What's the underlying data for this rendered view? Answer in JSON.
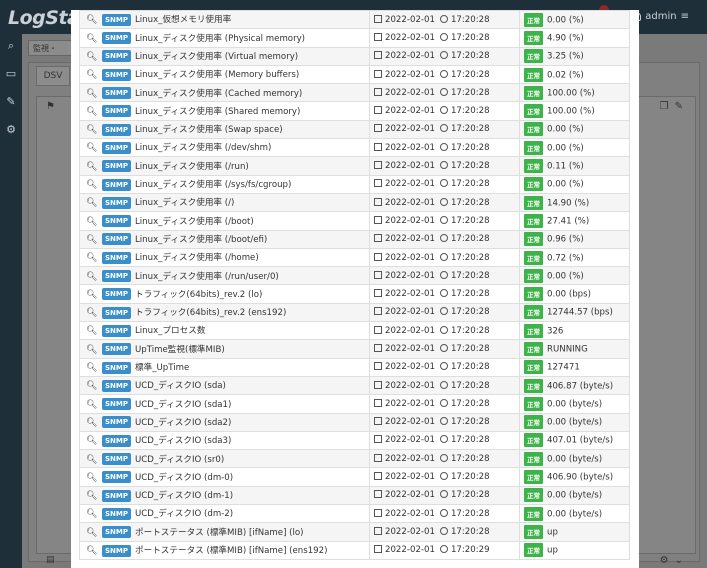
{
  "app": {
    "logo": "LogStar",
    "user": "admin",
    "search_label": "監視・",
    "tab_label": "DSV"
  },
  "colors": {
    "snmp_badge": "#3a8ec9",
    "status_ok": "#3db34a",
    "sidebar": "#1f2f3a"
  },
  "icons": [
    "search-icon",
    "monitor-icon",
    "wrench-icon",
    "gears-icon",
    "user-icon",
    "menu-icon",
    "calendar-icon",
    "clock-icon"
  ],
  "rows": [
    {
      "badge": "SNMP",
      "name": "Linux_仮想メモリ使用率",
      "date": "2022-02-01",
      "time": "17:20:28",
      "status": "正常",
      "value": "0.00 (%)"
    },
    {
      "badge": "SNMP",
      "name": "Linux_ディスク使用率 (Physical memory)",
      "date": "2022-02-01",
      "time": "17:20:28",
      "status": "正常",
      "value": "4.90 (%)"
    },
    {
      "badge": "SNMP",
      "name": "Linux_ディスク使用率 (Virtual memory)",
      "date": "2022-02-01",
      "time": "17:20:28",
      "status": "正常",
      "value": "3.25 (%)"
    },
    {
      "badge": "SNMP",
      "name": "Linux_ディスク使用率 (Memory buffers)",
      "date": "2022-02-01",
      "time": "17:20:28",
      "status": "正常",
      "value": "0.02 (%)"
    },
    {
      "badge": "SNMP",
      "name": "Linux_ディスク使用率 (Cached memory)",
      "date": "2022-02-01",
      "time": "17:20:28",
      "status": "正常",
      "value": "100.00 (%)"
    },
    {
      "badge": "SNMP",
      "name": "Linux_ディスク使用率 (Shared memory)",
      "date": "2022-02-01",
      "time": "17:20:28",
      "status": "正常",
      "value": "100.00 (%)"
    },
    {
      "badge": "SNMP",
      "name": "Linux_ディスク使用率 (Swap space)",
      "date": "2022-02-01",
      "time": "17:20:28",
      "status": "正常",
      "value": "0.00 (%)"
    },
    {
      "badge": "SNMP",
      "name": "Linux_ディスク使用率 (/dev/shm)",
      "date": "2022-02-01",
      "time": "17:20:28",
      "status": "正常",
      "value": "0.00 (%)"
    },
    {
      "badge": "SNMP",
      "name": "Linux_ディスク使用率 (/run)",
      "date": "2022-02-01",
      "time": "17:20:28",
      "status": "正常",
      "value": "0.11 (%)"
    },
    {
      "badge": "SNMP",
      "name": "Linux_ディスク使用率 (/sys/fs/cgroup)",
      "date": "2022-02-01",
      "time": "17:20:28",
      "status": "正常",
      "value": "0.00 (%)"
    },
    {
      "badge": "SNMP",
      "name": "Linux_ディスク使用率 (/)",
      "date": "2022-02-01",
      "time": "17:20:28",
      "status": "正常",
      "value": "14.90 (%)"
    },
    {
      "badge": "SNMP",
      "name": "Linux_ディスク使用率 (/boot)",
      "date": "2022-02-01",
      "time": "17:20:28",
      "status": "正常",
      "value": "27.41 (%)"
    },
    {
      "badge": "SNMP",
      "name": "Linux_ディスク使用率 (/boot/efi)",
      "date": "2022-02-01",
      "time": "17:20:28",
      "status": "正常",
      "value": "0.96 (%)"
    },
    {
      "badge": "SNMP",
      "name": "Linux_ディスク使用率 (/home)",
      "date": "2022-02-01",
      "time": "17:20:28",
      "status": "正常",
      "value": "0.72 (%)"
    },
    {
      "badge": "SNMP",
      "name": "Linux_ディスク使用率 (/run/user/0)",
      "date": "2022-02-01",
      "time": "17:20:28",
      "status": "正常",
      "value": "0.00 (%)"
    },
    {
      "badge": "SNMP",
      "name": "トラフィック(64bits)_rev.2 (lo)",
      "date": "2022-02-01",
      "time": "17:20:28",
      "status": "正常",
      "value": "0.00 (bps)"
    },
    {
      "badge": "SNMP",
      "name": "トラフィック(64bits)_rev.2 (ens192)",
      "date": "2022-02-01",
      "time": "17:20:28",
      "status": "正常",
      "value": "12744.57 (bps)"
    },
    {
      "badge": "SNMP",
      "name": "Linux_プロセス数",
      "date": "2022-02-01",
      "time": "17:20:28",
      "status": "正常",
      "value": "326"
    },
    {
      "badge": "SNMP",
      "name": "UpTime監視(標準MIB)",
      "date": "2022-02-01",
      "time": "17:20:28",
      "status": "正常",
      "value": "RUNNING"
    },
    {
      "badge": "SNMP",
      "name": "標準_UpTime",
      "date": "2022-02-01",
      "time": "17:20:28",
      "status": "正常",
      "value": "127471"
    },
    {
      "badge": "SNMP",
      "name": "UCD_ディスクIO (sda)",
      "date": "2022-02-01",
      "time": "17:20:28",
      "status": "正常",
      "value": "406.87 (byte/s)"
    },
    {
      "badge": "SNMP",
      "name": "UCD_ディスクIO (sda1)",
      "date": "2022-02-01",
      "time": "17:20:28",
      "status": "正常",
      "value": "0.00 (byte/s)"
    },
    {
      "badge": "SNMP",
      "name": "UCD_ディスクIO (sda2)",
      "date": "2022-02-01",
      "time": "17:20:28",
      "status": "正常",
      "value": "0.00 (byte/s)"
    },
    {
      "badge": "SNMP",
      "name": "UCD_ディスクIO (sda3)",
      "date": "2022-02-01",
      "time": "17:20:28",
      "status": "正常",
      "value": "407.01 (byte/s)"
    },
    {
      "badge": "SNMP",
      "name": "UCD_ディスクIO (sr0)",
      "date": "2022-02-01",
      "time": "17:20:28",
      "status": "正常",
      "value": "0.00 (byte/s)"
    },
    {
      "badge": "SNMP",
      "name": "UCD_ディスクIO (dm-0)",
      "date": "2022-02-01",
      "time": "17:20:28",
      "status": "正常",
      "value": "406.90 (byte/s)"
    },
    {
      "badge": "SNMP",
      "name": "UCD_ディスクIO (dm-1)",
      "date": "2022-02-01",
      "time": "17:20:28",
      "status": "正常",
      "value": "0.00 (byte/s)"
    },
    {
      "badge": "SNMP",
      "name": "UCD_ディスクIO (dm-2)",
      "date": "2022-02-01",
      "time": "17:20:28",
      "status": "正常",
      "value": "0.00 (byte/s)"
    },
    {
      "badge": "SNMP",
      "name": "ポートステータス (標準MIB) [ifName] (lo)",
      "date": "2022-02-01",
      "time": "17:20:28",
      "status": "正常",
      "value": "up"
    },
    {
      "badge": "SNMP",
      "name": "ポートステータス (標準MIB) [ifName] (ens192)",
      "date": "2022-02-01",
      "time": "17:20:29",
      "status": "正常",
      "value": "up"
    }
  ]
}
